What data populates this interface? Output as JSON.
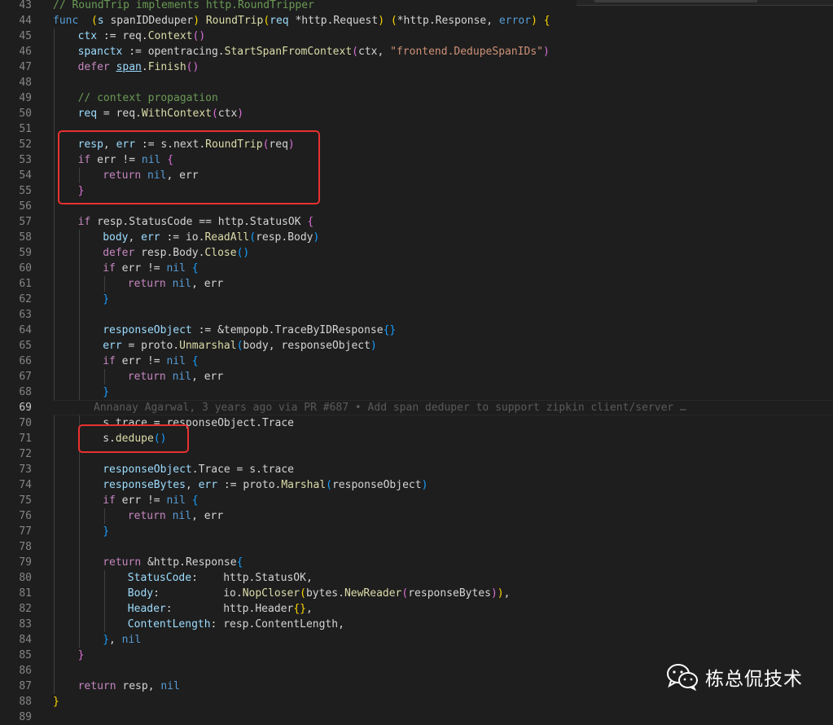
{
  "editor": {
    "active_line": "69",
    "blame": "Annanay Agarwal, 3 years ago via PR #687 • Add span deduper to support zipkin client/server …",
    "lines": [
      {
        "n": "43",
        "g": [],
        "t": [
          [
            "cm",
            "// RoundTrip implements http.RoundTripper"
          ]
        ]
      },
      {
        "n": "44",
        "g": [],
        "t": [
          [
            "kw",
            "func"
          ],
          [
            "",
            "  "
          ],
          [
            "b1",
            "("
          ],
          [
            "var",
            "s"
          ],
          [
            "",
            " spanIDDeduper"
          ],
          [
            "b1",
            ")"
          ],
          [
            "",
            " "
          ],
          [
            "fn",
            "RoundTrip"
          ],
          [
            "b1",
            "("
          ],
          [
            "var",
            "req"
          ],
          [
            "",
            " *http.Request"
          ],
          [
            "b1",
            ")"
          ],
          [
            "",
            " "
          ],
          [
            "b1",
            "("
          ],
          [
            "",
            "*http.Response, "
          ],
          [
            "kw",
            "error"
          ],
          [
            "b1",
            ")"
          ],
          [
            "",
            " "
          ],
          [
            "b1",
            "{"
          ]
        ]
      },
      {
        "n": "45",
        "g": [
          1
        ],
        "t": [
          [
            "var",
            "ctx"
          ],
          [
            "",
            " := req."
          ],
          [
            "fn",
            "Context"
          ],
          [
            "b2",
            "()"
          ]
        ]
      },
      {
        "n": "46",
        "g": [
          1
        ],
        "t": [
          [
            "var",
            "span"
          ],
          [
            ", ",
            ""
          ],
          [
            "var",
            "ctx"
          ],
          [
            "",
            " := opentracing."
          ],
          [
            "fn",
            "StartSpanFromContext"
          ],
          [
            "b2",
            "("
          ],
          [
            "",
            "ctx, "
          ],
          [
            "str",
            "\"frontend.DedupeSpanIDs\""
          ],
          [
            "b2",
            ")"
          ]
        ]
      },
      {
        "n": "47",
        "g": [
          1
        ],
        "t": [
          [
            "ctl",
            "defer"
          ],
          [
            "",
            " "
          ],
          [
            "var u",
            "span"
          ],
          [
            "",
            "."
          ],
          [
            "fn",
            "Finish"
          ],
          [
            "b2",
            "()"
          ]
        ]
      },
      {
        "n": "48",
        "g": [
          1
        ],
        "t": []
      },
      {
        "n": "49",
        "g": [
          1
        ],
        "t": [
          [
            "cm",
            "// context propagation"
          ]
        ]
      },
      {
        "n": "50",
        "g": [
          1
        ],
        "t": [
          [
            "var",
            "req"
          ],
          [
            "",
            " = req."
          ],
          [
            "fn",
            "WithContext"
          ],
          [
            "b2",
            "("
          ],
          [
            "",
            "ctx"
          ],
          [
            "b2",
            ")"
          ]
        ]
      },
      {
        "n": "51",
        "g": [
          1
        ],
        "t": []
      },
      {
        "n": "52",
        "g": [
          1
        ],
        "t": [
          [
            "var",
            "resp"
          ],
          [
            "",
            ", "
          ],
          [
            "var",
            "err"
          ],
          [
            "",
            " := s.next."
          ],
          [
            "fn",
            "RoundTrip"
          ],
          [
            "b2",
            "("
          ],
          [
            "",
            "req"
          ],
          [
            "b2",
            ")"
          ]
        ]
      },
      {
        "n": "53",
        "g": [
          1
        ],
        "t": [
          [
            "ctl",
            "if"
          ],
          [
            "",
            " err != "
          ],
          [
            "kw",
            "nil"
          ],
          [
            "",
            " "
          ],
          [
            "b2",
            "{"
          ]
        ]
      },
      {
        "n": "54",
        "g": [
          1,
          2
        ],
        "t": [
          [
            "ctl",
            "return"
          ],
          [
            "",
            " "
          ],
          [
            "kw",
            "nil"
          ],
          [
            "",
            ", err"
          ]
        ]
      },
      {
        "n": "55",
        "g": [
          1
        ],
        "t": [
          [
            "b2",
            "}"
          ]
        ]
      },
      {
        "n": "56",
        "g": [
          1
        ],
        "t": []
      },
      {
        "n": "57",
        "g": [
          1
        ],
        "t": [
          [
            "ctl",
            "if"
          ],
          [
            "",
            " resp.StatusCode == http.StatusOK "
          ],
          [
            "b2",
            "{"
          ]
        ]
      },
      {
        "n": "58",
        "g": [
          1,
          2
        ],
        "t": [
          [
            "var",
            "body"
          ],
          [
            "",
            ", "
          ],
          [
            "var",
            "err"
          ],
          [
            "",
            " := io."
          ],
          [
            "fn",
            "ReadAll"
          ],
          [
            "b3",
            "("
          ],
          [
            "",
            "resp.Body"
          ],
          [
            "b3",
            ")"
          ]
        ]
      },
      {
        "n": "59",
        "g": [
          1,
          2
        ],
        "t": [
          [
            "ctl",
            "defer"
          ],
          [
            "",
            " resp.Body."
          ],
          [
            "fn",
            "Close"
          ],
          [
            "b3",
            "()"
          ]
        ]
      },
      {
        "n": "60",
        "g": [
          1,
          2
        ],
        "t": [
          [
            "ctl",
            "if"
          ],
          [
            "",
            " err != "
          ],
          [
            "kw",
            "nil"
          ],
          [
            "",
            " "
          ],
          [
            "b3",
            "{"
          ]
        ]
      },
      {
        "n": "61",
        "g": [
          1,
          2,
          3
        ],
        "t": [
          [
            "ctl",
            "return"
          ],
          [
            "",
            " "
          ],
          [
            "kw",
            "nil"
          ],
          [
            "",
            ", err"
          ]
        ]
      },
      {
        "n": "62",
        "g": [
          1,
          2
        ],
        "t": [
          [
            "b3",
            "}"
          ]
        ]
      },
      {
        "n": "63",
        "g": [
          1,
          2
        ],
        "t": []
      },
      {
        "n": "64",
        "g": [
          1,
          2
        ],
        "t": [
          [
            "var",
            "responseObject"
          ],
          [
            "",
            " := &tempopb.TraceByIDResponse"
          ],
          [
            "b3",
            "{}"
          ]
        ]
      },
      {
        "n": "65",
        "g": [
          1,
          2
        ],
        "t": [
          [
            "var",
            "err"
          ],
          [
            "",
            " = proto."
          ],
          [
            "fn",
            "Unmarshal"
          ],
          [
            "b3",
            "("
          ],
          [
            "",
            "body, responseObject"
          ],
          [
            "b3",
            ")"
          ]
        ]
      },
      {
        "n": "66",
        "g": [
          1,
          2
        ],
        "t": [
          [
            "ctl",
            "if"
          ],
          [
            "",
            " err != "
          ],
          [
            "kw",
            "nil"
          ],
          [
            "",
            " "
          ],
          [
            "b3",
            "{"
          ]
        ]
      },
      {
        "n": "67",
        "g": [
          1,
          2,
          3
        ],
        "t": [
          [
            "ctl",
            "return"
          ],
          [
            "",
            " "
          ],
          [
            "kw",
            "nil"
          ],
          [
            "",
            ", err"
          ]
        ]
      },
      {
        "n": "68",
        "g": [
          1,
          2
        ],
        "t": [
          [
            "b3",
            "}"
          ]
        ]
      },
      {
        "n": "69",
        "g": [],
        "t": [],
        "blame": true
      },
      {
        "n": "70",
        "g": [
          1,
          2
        ],
        "t": [
          [
            "",
            "s.trace = responseObject.Trace"
          ]
        ]
      },
      {
        "n": "71",
        "g": [
          1,
          2
        ],
        "t": [
          [
            "",
            "s."
          ],
          [
            "fn",
            "dedupe"
          ],
          [
            "b3",
            "()"
          ]
        ]
      },
      {
        "n": "72",
        "g": [
          1,
          2
        ],
        "t": []
      },
      {
        "n": "73",
        "g": [
          1,
          2
        ],
        "t": [
          [
            "var",
            "responseObject"
          ],
          [
            "",
            ".Trace = s.trace"
          ]
        ]
      },
      {
        "n": "74",
        "g": [
          1,
          2
        ],
        "t": [
          [
            "var",
            "responseBytes"
          ],
          [
            "",
            ", "
          ],
          [
            "var",
            "err"
          ],
          [
            "",
            " := proto."
          ],
          [
            "fn",
            "Marshal"
          ],
          [
            "b3",
            "("
          ],
          [
            "",
            "responseObject"
          ],
          [
            "b3",
            ")"
          ]
        ]
      },
      {
        "n": "75",
        "g": [
          1,
          2
        ],
        "t": [
          [
            "ctl",
            "if"
          ],
          [
            "",
            " err != "
          ],
          [
            "kw",
            "nil"
          ],
          [
            "",
            " "
          ],
          [
            "b3",
            "{"
          ]
        ]
      },
      {
        "n": "76",
        "g": [
          1,
          2,
          3
        ],
        "t": [
          [
            "ctl",
            "return"
          ],
          [
            "",
            " "
          ],
          [
            "kw",
            "nil"
          ],
          [
            "",
            ", err"
          ]
        ]
      },
      {
        "n": "77",
        "g": [
          1,
          2
        ],
        "t": [
          [
            "b3",
            "}"
          ]
        ]
      },
      {
        "n": "78",
        "g": [
          1,
          2
        ],
        "t": []
      },
      {
        "n": "79",
        "g": [
          1,
          2
        ],
        "t": [
          [
            "ctl",
            "return"
          ],
          [
            "",
            " &http.Response"
          ],
          [
            "b3",
            "{"
          ]
        ]
      },
      {
        "n": "80",
        "g": [
          1,
          2,
          3
        ],
        "t": [
          [
            "var",
            "StatusCode"
          ],
          [
            "",
            ":    http.StatusOK,"
          ]
        ]
      },
      {
        "n": "81",
        "g": [
          1,
          2,
          3
        ],
        "t": [
          [
            "var",
            "Body"
          ],
          [
            "",
            ":          io."
          ],
          [
            "fn",
            "NopCloser"
          ],
          [
            "b1",
            "("
          ],
          [
            "",
            "bytes."
          ],
          [
            "fn",
            "NewReader"
          ],
          [
            "b2",
            "("
          ],
          [
            "",
            "responseBytes"
          ],
          [
            "b2",
            ")"
          ],
          [
            "b1",
            ")"
          ],
          [
            "",
            ","
          ]
        ]
      },
      {
        "n": "82",
        "g": [
          1,
          2,
          3
        ],
        "t": [
          [
            "var",
            "Header"
          ],
          [
            "",
            ":        http.Header"
          ],
          [
            "b1",
            "{}"
          ],
          [
            "",
            ","
          ]
        ]
      },
      {
        "n": "83",
        "g": [
          1,
          2,
          3
        ],
        "t": [
          [
            "var",
            "ContentLength"
          ],
          [
            "",
            ": resp.ContentLength,"
          ]
        ]
      },
      {
        "n": "84",
        "g": [
          1,
          2
        ],
        "t": [
          [
            "b3",
            "}"
          ],
          [
            "",
            ", "
          ],
          [
            "kw",
            "nil"
          ]
        ]
      },
      {
        "n": "85",
        "g": [
          1
        ],
        "t": [
          [
            "b2",
            "}"
          ]
        ]
      },
      {
        "n": "86",
        "g": [
          1
        ],
        "t": []
      },
      {
        "n": "87",
        "g": [
          1
        ],
        "t": [
          [
            "ctl",
            "return"
          ],
          [
            "",
            " resp, "
          ],
          [
            "kw",
            "nil"
          ]
        ]
      },
      {
        "n": "88",
        "g": [],
        "t": [
          [
            "b1",
            "}"
          ]
        ]
      },
      {
        "n": "89",
        "g": [],
        "t": []
      }
    ]
  },
  "watermark": {
    "text": "栋总侃技术",
    "icon": "wechat-icon"
  },
  "highlight_color": "#e8312f"
}
